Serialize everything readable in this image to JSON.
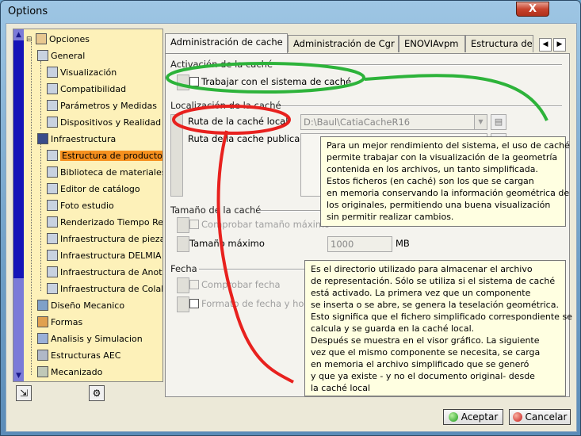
{
  "window": {
    "title": "Options",
    "close_glyph": "X"
  },
  "tree": {
    "root": "Opciones",
    "items": [
      {
        "label": "General",
        "icon": "general-icon"
      },
      {
        "label": "Visualización",
        "icon": "display-icon"
      },
      {
        "label": "Compatibilidad",
        "icon": "compatibility-icon"
      },
      {
        "label": "Parámetros y Medidas",
        "icon": "parameters-icon"
      },
      {
        "label": "Dispositivos y Realidad V",
        "icon": "devices-icon"
      },
      {
        "label": "Infraestructura",
        "icon": "infrastructure-icon"
      },
      {
        "label": "Estructura de producto",
        "icon": "product-structure-icon",
        "selected": true
      },
      {
        "label": "Biblioteca de materiales",
        "icon": "material-library-icon"
      },
      {
        "label": "Editor de catálogo",
        "icon": "catalog-editor-icon"
      },
      {
        "label": "Foto estudio",
        "icon": "photo-studio-icon"
      },
      {
        "label": "Renderizado Tiempo Rea",
        "icon": "rendering-icon"
      },
      {
        "label": "Infraestructura de piezas",
        "icon": "part-infrastructure-icon"
      },
      {
        "label": "Infraestructura DELMIA",
        "icon": "delmia-icon"
      },
      {
        "label": "Infraestructura de Anotac",
        "icon": "annotation-icon"
      },
      {
        "label": "Infraestructura de Colabor",
        "icon": "collaboration-icon"
      },
      {
        "label": "Diseño Mecanico",
        "icon": "mechanical-design-icon"
      },
      {
        "label": "Formas",
        "icon": "shapes-icon"
      },
      {
        "label": "Analisis y Simulacion",
        "icon": "analysis-icon"
      },
      {
        "label": "Estructuras AEC",
        "icon": "aec-icon"
      },
      {
        "label": "Mecanizado",
        "icon": "machining-icon"
      }
    ]
  },
  "tabs": [
    {
      "label": "Administración de cache",
      "active": true
    },
    {
      "label": "Administración de Cgr"
    },
    {
      "label": "ENOVIAvpm"
    },
    {
      "label": "Estructura de p"
    }
  ],
  "sections": {
    "activation": {
      "title": "Activación de la caché",
      "checkbox_label": "Trabajar con el sistema de caché"
    },
    "location": {
      "title": "Localización de la caché",
      "local_label": "Ruta de la caché local",
      "local_value": "D:\\Baul\\CatiaCacheR16",
      "published_label": "Ruta de la cache publicada"
    },
    "size": {
      "title": "Tamaño de la caché",
      "check_label": "Comprobar tamaño máximo",
      "max_label": "Tamaño máximo",
      "max_value": "1000",
      "unit": "MB"
    },
    "date": {
      "title": "Fecha",
      "check_label": "Comprobar fecha",
      "format_label": "Formato de fecha y hora"
    }
  },
  "tooltips": {
    "top": "Para un mejor rendimiento del sistema, el uso de caché\npermite trabajar con la visualización de la geometría\ncontenida en los archivos, un tanto simplificada.\nEstos ficheros (en caché) son los que se cargan\nen memoria conservando la información geométrica de\nlos originales, permitiendo una buena visualización\nsin permitir realizar cambios.",
    "bottom": "Es el directorio utilizado para almacenar el archivo\nde representación. Sólo se utiliza si el sistema de caché\nestá activado. La primera vez que un componente\nse inserta o se abre, se genera la teselación geométrica.\nEsto significa que el fichero simplificado correspondiente se\ncalcula y se guarda en la caché local.\nDespués se muestra en el visor gráfico. La siguiente\nvez que el mismo componente se necesita, se carga\nen memoria el archivo simplificado que se generó\ny que ya existe - y no el documento original- desde\nla caché local"
  },
  "buttons": {
    "ok": "Aceptar",
    "cancel": "Cancelar"
  },
  "colors": {
    "selection": "#f6901e",
    "annotation_green": "#2db33a",
    "annotation_red": "#e8211e",
    "tooltip_bg": "#ffffe1"
  }
}
